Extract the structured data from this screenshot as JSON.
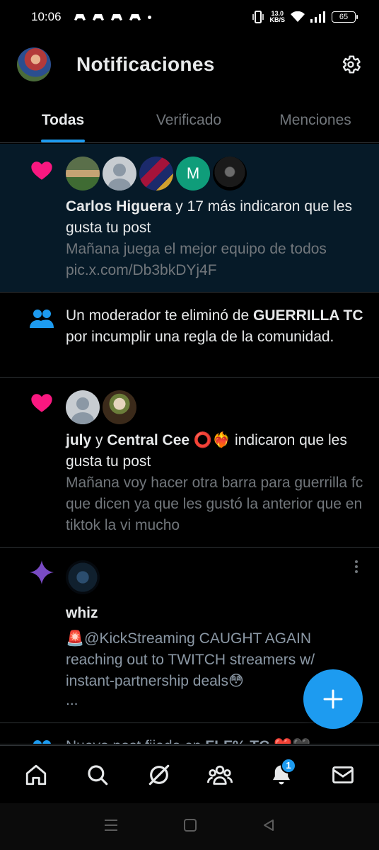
{
  "status_bar": {
    "time": "10:06",
    "net_speed_value": "13.0",
    "net_speed_unit": "KB/S",
    "battery": "65"
  },
  "header": {
    "title": "Notificaciones"
  },
  "tabs": [
    {
      "label": "Todas",
      "active": true
    },
    {
      "label": "Verificado",
      "active": false
    },
    {
      "label": "Menciones",
      "active": false
    }
  ],
  "notifications": [
    {
      "type": "like",
      "icon": "heart-icon",
      "avatar_letter": "M",
      "actor": "Carlos Higuera",
      "text": " y 17 más indicaron que les gusta tu post",
      "sub1": "Mañana juega el mejor equipo de todos",
      "sub2": "pic.x.com/Db3bkDYj4F"
    },
    {
      "type": "community",
      "icon": "people-icon",
      "text_before": "Un moderador te eliminó de ",
      "community": "GUERRILLA TC",
      "text_after": " por incumplir una regla de la comunidad."
    },
    {
      "type": "like",
      "icon": "heart-icon",
      "actor1": "july",
      "joiner": " y ",
      "actor2": "Central Cee",
      "emoji": "⭕❤️‍🔥",
      "text": " indicaron que les gusta tu post",
      "sub": "Mañana voy hacer otra barra para guerrilla fc que dicen ya que les gustó la anterior que en tiktok la vi mucho"
    },
    {
      "type": "recommendation",
      "icon": "sparkle-icon",
      "actor": "whiz",
      "line1": "🚨@KickStreaming CAUGHT AGAIN reaching out to TWITCH streamers w/ instant-partnership deals😳",
      "line2": "..."
    },
    {
      "type": "community",
      "icon": "people-icon",
      "text_before": "Nuevo post fijado en ",
      "community": "FLF% TC",
      "text_after": " ❤️🖤"
    }
  ],
  "bottom_nav": {
    "notifications_badge": "1"
  },
  "colors": {
    "accent": "#1d9bf0",
    "like": "#f91880",
    "sparkle": "#794bc4",
    "highlight_bg": "#061a28"
  }
}
